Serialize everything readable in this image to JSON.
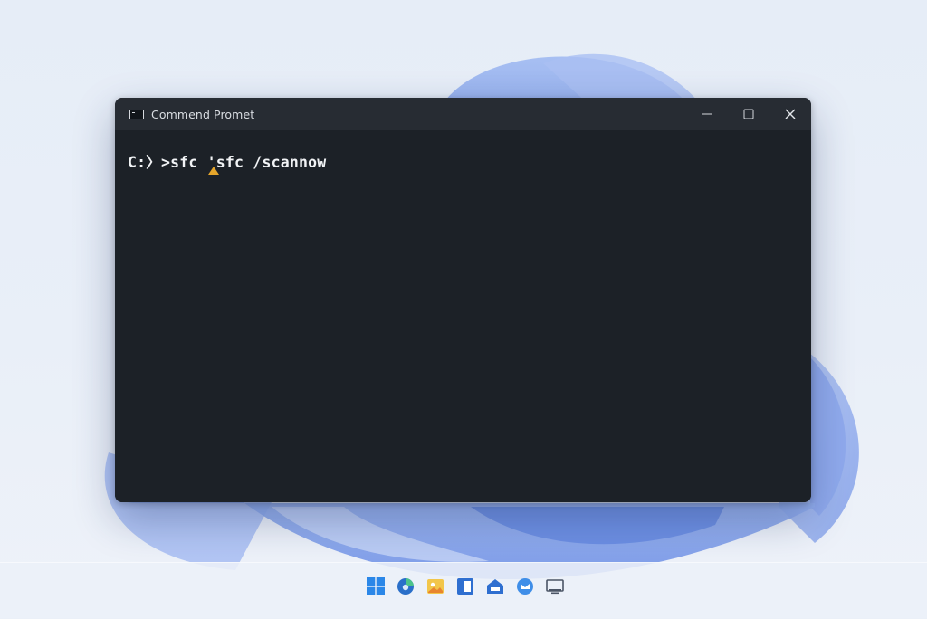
{
  "window": {
    "title": "Commend Promet",
    "controls": {
      "minimize_icon": "minimize-icon",
      "maximize_icon": "maximize-icon",
      "close_icon": "close-icon"
    }
  },
  "console": {
    "prompt_line": "C:〉>sfc 'sfc /scannow"
  },
  "taskbar": {
    "icons": [
      "start-windows-icon",
      "browser-icon",
      "photos-icon",
      "panel-icon",
      "store-icon",
      "mail-icon",
      "monitor-icon"
    ]
  },
  "colors": {
    "console_bg": "#1c2127",
    "titlebar_bg": "#272c33",
    "text": "#f1f3f5",
    "caret_marker": "#e6a62b",
    "accent_blue": "#2b7fe0"
  }
}
